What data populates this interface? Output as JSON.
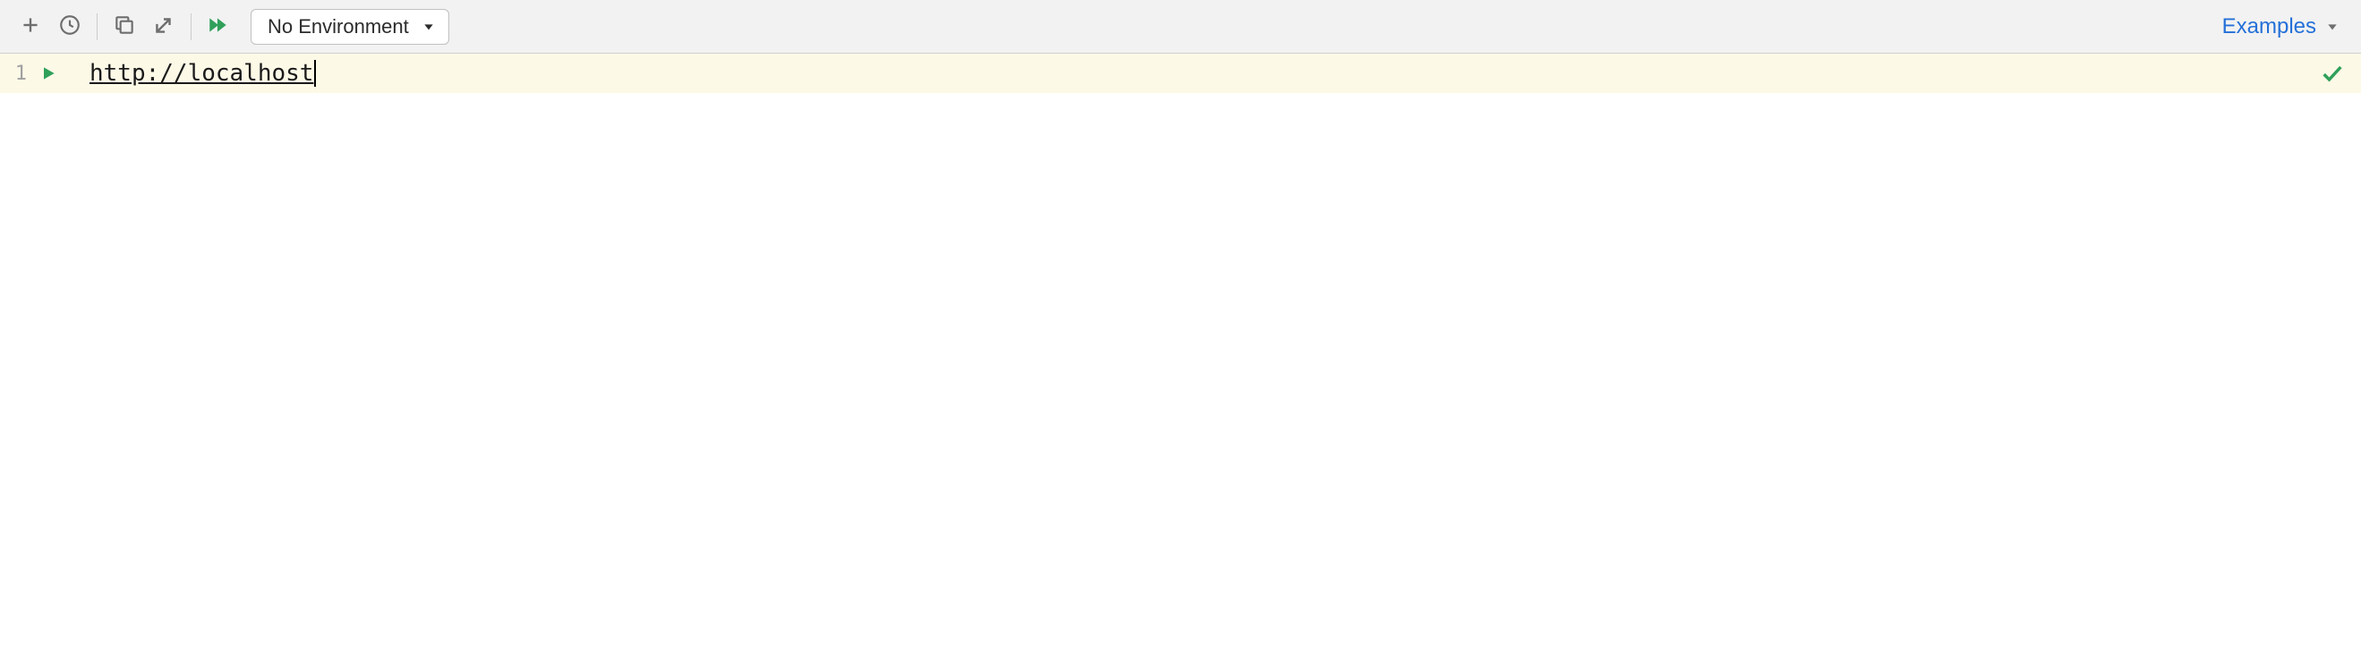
{
  "toolbar": {
    "environment_label": "No Environment",
    "examples_label": "Examples"
  },
  "editor": {
    "line_number": "1",
    "content": "http://localhost"
  }
}
